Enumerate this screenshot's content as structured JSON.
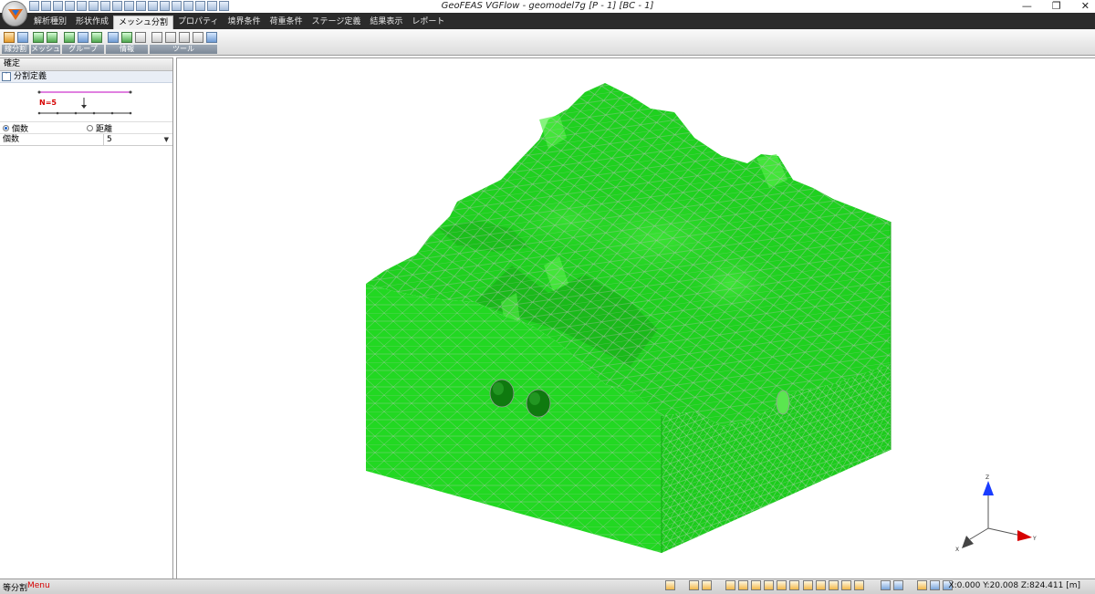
{
  "window": {
    "title": "GeoFEAS VGFlow - geomodel7g [P - 1] [BC - 1]",
    "minimize_glyph": "—",
    "restore_glyph": "❐",
    "close_glyph": "✕"
  },
  "menu": {
    "items": [
      "解析種別",
      "形状作成",
      "メッシュ分割",
      "プロパティ",
      "境界条件",
      "荷重条件",
      "ステージ定義",
      "結果表示",
      "レポート"
    ],
    "active": "メッシュ分割"
  },
  "ribbon": {
    "groups": [
      "線分割",
      "メッシュ",
      "グループ",
      "情報",
      "ツール"
    ]
  },
  "left_panel": {
    "header": "確定",
    "section_title": "分割定義",
    "preview_label": "N=5",
    "radio_count": "個数",
    "radio_distance": "距離",
    "prop_name": "個数",
    "prop_value": "5"
  },
  "status": {
    "mode": "等分割",
    "menu": "Menu",
    "coords": "X:0.000 Y:20.008 Z:824.411 [m]"
  },
  "axes": {
    "z": "Z",
    "y": "Y",
    "x": "X"
  },
  "colors": {
    "mesh_green": "#1fd11f",
    "accent_red": "#d60000",
    "axis_blue": "#1a3cff"
  }
}
